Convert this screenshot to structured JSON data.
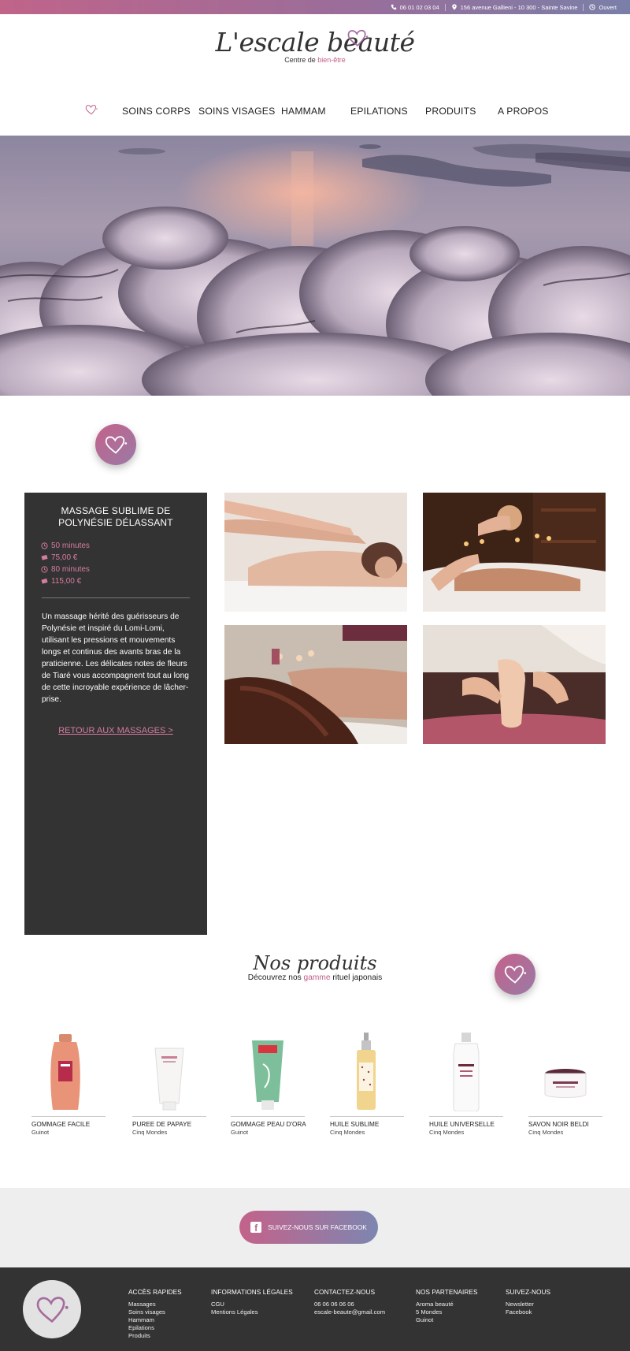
{
  "topbar": {
    "phone": "06 01 02 03 04",
    "address": "156 avenue Gallieni - 10 300 - Sainte Savine",
    "status": "Ouvert"
  },
  "brand": {
    "name": "L'escale beauté",
    "tagline_prefix": "Centre de ",
    "tagline_accent": "bien-être"
  },
  "nav": {
    "items": [
      "SOINS CORPS",
      "SOINS VISAGES",
      "HAMMAM",
      "EPILATIONS",
      "PRODUITS",
      "A PROPOS"
    ]
  },
  "treatment": {
    "title": "MASSAGE SUBLIME DE POLYNÉSIE DÉLASSANT",
    "facts": [
      {
        "icon": "clock-icon",
        "text": "50 minutes"
      },
      {
        "icon": "ticket-icon",
        "text": "75,00 €"
      },
      {
        "icon": "clock-icon",
        "text": "80 minutes"
      },
      {
        "icon": "ticket-icon",
        "text": "115,00 €"
      }
    ],
    "description": "Un massage hérité des guérisseurs de Polynésie et inspiré du Lomi-Lomi, utilisant les pressions et mouvements longs et continus des avants bras de la praticienne. Les délicates notes de fleurs de Tiaré vous accompagnent tout au long de cette incroyable expérience de lâcher-prise.",
    "back_link": "RETOUR AUX MASSAGES >"
  },
  "products_section": {
    "title": "Nos produits",
    "subtitle_prefix": "Découvrez nos ",
    "subtitle_accent": "gamme",
    "subtitle_suffix": " rituel japonais"
  },
  "products": [
    {
      "name": "GOMMAGE FACILE",
      "brand": "Guinot"
    },
    {
      "name": "PUREE DE PAPAYE",
      "brand": "Cinq Mondes"
    },
    {
      "name": "GOMMAGE PEAU D'ORA",
      "brand": "Guinot"
    },
    {
      "name": "HUILE SUBLIME",
      "brand": "Cinq Mondes"
    },
    {
      "name": "HUILE UNIVERSELLE",
      "brand": "Cinq Mondes"
    },
    {
      "name": "SAVON NOIR BELDI",
      "brand": "Cinq Mondes"
    }
  ],
  "facebook": {
    "label": "SUIVEZ-NOUS SUR FACEBOOK"
  },
  "footer": {
    "columns": [
      {
        "title": "ACCÈS RAPIDES",
        "links": [
          "Massages",
          "Soins visages",
          "Hammam",
          "Epilations",
          "Produits"
        ]
      },
      {
        "title": "INFORMATIONS LÉGALES",
        "links": [
          "CGU",
          "Mentions Légales"
        ]
      },
      {
        "title": "CONTACTEZ-NOUS",
        "links": [
          "06 06 06 06 06",
          "escale-beaute@gmail.com"
        ]
      },
      {
        "title": "NOS PARTENAIRES",
        "links": [
          "Aroma beauté",
          "5 Mondes",
          "Guinot"
        ]
      },
      {
        "title": "SUIVEZ-NOUS",
        "links": [
          "Newsletter",
          "Facebook"
        ]
      }
    ]
  },
  "colors": {
    "accent": "#c15d88",
    "dark": "#333333",
    "gradient_start": "#c0648a",
    "gradient_end": "#7a7fa8"
  }
}
